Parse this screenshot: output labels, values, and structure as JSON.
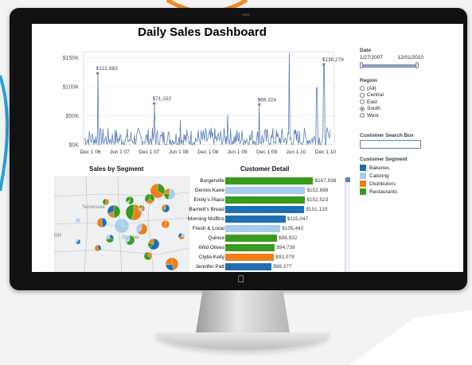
{
  "dashboard": {
    "title": "Daily Sales Dashboard",
    "segment_map_title": "Sales by Segment",
    "customer_detail_title": "Customer Detail",
    "map_labels": {
      "state_a": "Tennessee",
      "state_b": "Georgia",
      "state_c": "ippi"
    }
  },
  "filters": {
    "date_label": "Date",
    "date_start": "1/27/2007",
    "date_end": "12/01/2010",
    "region_label": "Region",
    "regions": [
      {
        "label": "(All)",
        "selected": false
      },
      {
        "label": "Central",
        "selected": false
      },
      {
        "label": "East",
        "selected": false
      },
      {
        "label": "South",
        "selected": true
      },
      {
        "label": "West",
        "selected": false
      }
    ],
    "search_label": "Customer Search Box",
    "search_value": "",
    "segment_label": "Customer Segment",
    "segments": [
      {
        "label": "Bakeries",
        "color": "#1f6fb4"
      },
      {
        "label": "Catering",
        "color": "#a9cdec"
      },
      {
        "label": "Distributors",
        "color": "#f07f1a"
      },
      {
        "label": "Restaurants",
        "color": "#3a9a1e"
      }
    ]
  },
  "chart_data": [
    {
      "type": "line",
      "title": "Daily Sales Dashboard",
      "x_tick_labels": [
        "Dec 1 06",
        "Jun 1 07",
        "Dec 1 07",
        "Jun 1 08",
        "Dec 1 08",
        "Jun 1 09",
        "Dec 1 09",
        "Jun 1 10",
        "Dec 1 10"
      ],
      "y_tick_labels": [
        "$150K",
        "$100K",
        "$50K",
        "$0K"
      ],
      "ylim": [
        0,
        160000
      ],
      "annotations": [
        {
          "label": "$122,883",
          "value": 122883,
          "x": "2007-01-15"
        },
        {
          "label": "$71,152",
          "value": 71152,
          "x": "2008-01-01"
        },
        {
          "label": "$69,324",
          "value": 69324,
          "x": "2009-10-15"
        },
        {
          "label": "$138,279",
          "value": 138279,
          "x": "2010-11-20"
        }
      ],
      "peaks": [
        {
          "x": "2007-01-15",
          "value": 122883
        },
        {
          "x": "2008-01-01",
          "value": 71152
        },
        {
          "x": "2008-06-15",
          "value": 43000
        },
        {
          "x": "2009-04-01",
          "value": 52000
        },
        {
          "x": "2009-10-15",
          "value": 69324
        },
        {
          "x": "2010-04-20",
          "value": 158000
        },
        {
          "x": "2010-10-10",
          "value": 98000
        },
        {
          "x": "2010-11-20",
          "value": 138279
        }
      ],
      "baseline_range": [
        0,
        30000
      ],
      "color": "#5b7fb5"
    },
    {
      "type": "bar",
      "title": "Customer Detail",
      "categories": [
        "Burgerville",
        "Dennis Kane",
        "Emily's Place",
        "Barnett's Bread",
        "Morning Muffins",
        "Fresh & Local",
        "Quince",
        "Wild Olives",
        "Clytie Kelly",
        "Jennifer Patt"
      ],
      "values": [
        167938,
        152688,
        152523,
        151133,
        115047,
        105442,
        98932,
        94738,
        93079,
        88377
      ],
      "value_labels": [
        "$167,938",
        "$152,688",
        "$152,523",
        "$151,133",
        "$115,047",
        "$105,442",
        "$98,932",
        "$94,738",
        "$93,079",
        "$88,377"
      ],
      "segments": [
        "Restaurants",
        "Catering",
        "Restaurants",
        "Bakeries",
        "Bakeries",
        "Catering",
        "Restaurants",
        "Restaurants",
        "Distributors",
        "Bakeries"
      ]
    },
    {
      "type": "scatter",
      "title": "Sales by Segment",
      "points": [
        {
          "segment_mix": [
            "Restaurants",
            "Catering"
          ]
        },
        {
          "segment_mix": [
            "Restaurants",
            "Bakeries"
          ]
        },
        {
          "segment_mix": [
            "Bakeries",
            "Distributors"
          ]
        },
        {
          "segment_mix": [
            "Restaurants",
            "Catering",
            "Bakeries"
          ]
        }
      ]
    }
  ]
}
